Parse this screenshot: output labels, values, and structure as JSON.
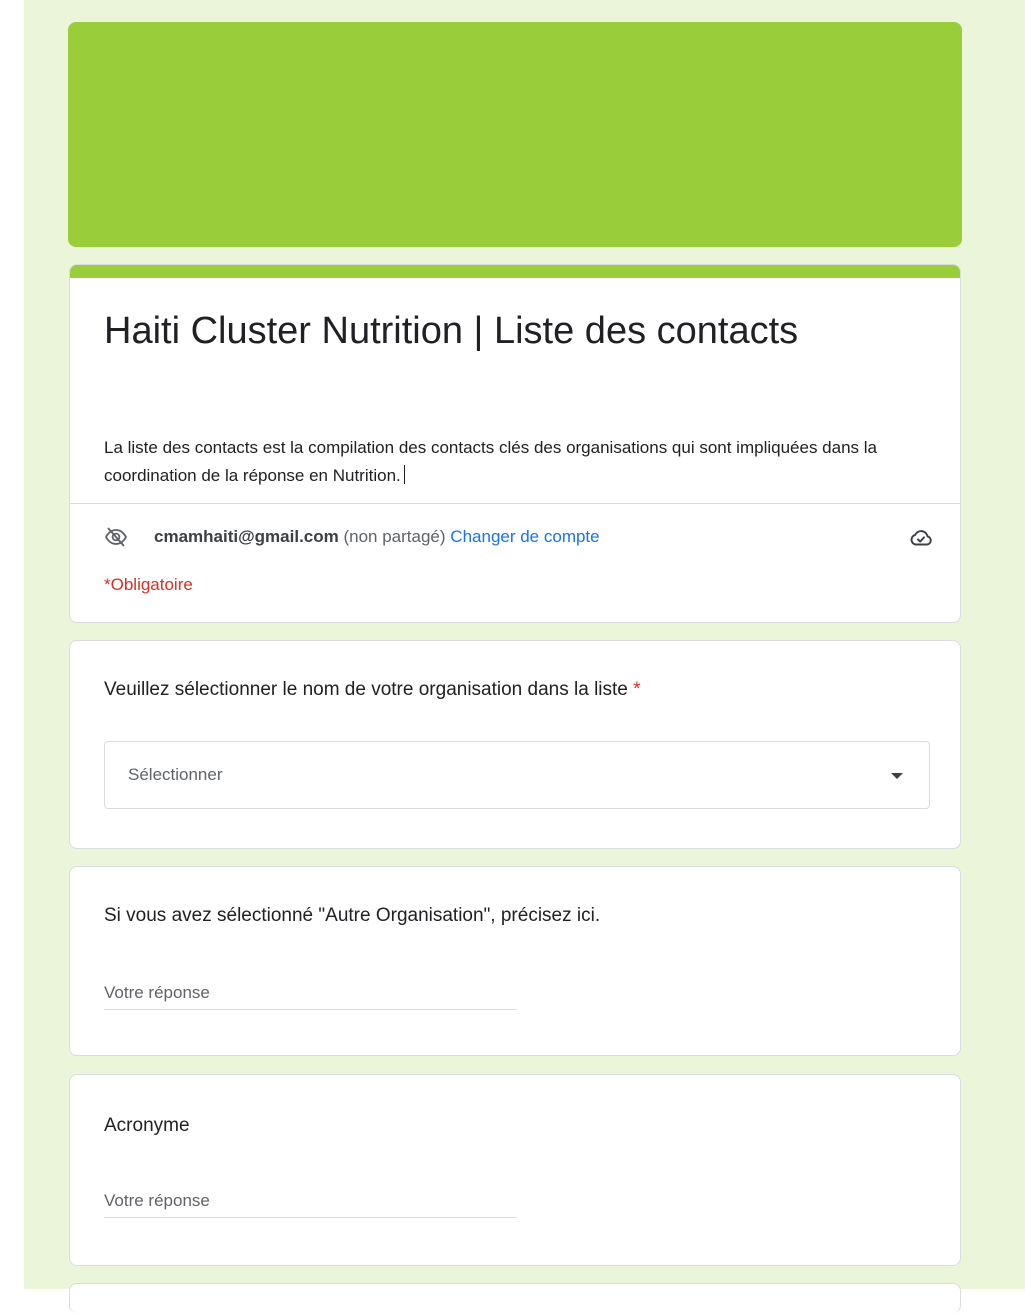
{
  "form": {
    "title": "Haiti Cluster Nutrition | Liste des contacts",
    "description": "La liste des contacts est la compilation des contacts clés des organisations qui sont impliquées dans la coordination de la réponse en Nutrition.",
    "account": {
      "email": "cmamhaiti@gmail.com",
      "status": "(non partagé)",
      "switch_label": "Changer de compte",
      "privacy_icon": "eye-off-icon",
      "save_icon": "cloud-check-icon"
    },
    "required_note": "*Obligatoire"
  },
  "questions": [
    {
      "label": "Veuillez sélectionner le nom de votre organisation dans la liste",
      "required_mark": "*",
      "type": "dropdown",
      "selected_text": "Sélectionner"
    },
    {
      "label": "Si vous avez sélectionné \"Autre Organisation\", précisez ici.",
      "type": "short_text",
      "placeholder": "Votre réponse"
    },
    {
      "label": "Acronyme",
      "type": "short_text",
      "placeholder": "Votre réponse"
    }
  ],
  "theme": {
    "accent": "#9acd3a",
    "background": "#eaf5da",
    "link": "#1a73e8",
    "required": "#d93025"
  }
}
